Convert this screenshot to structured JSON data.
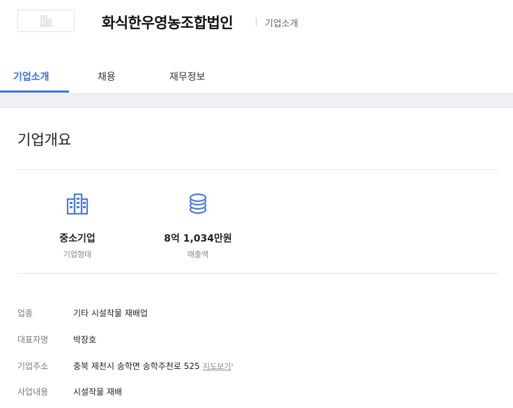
{
  "header": {
    "logo_icon": "building-icon",
    "company_name": "화식한우영농조합법인",
    "subtitle": "기업소개"
  },
  "tabs": [
    {
      "label": "기업소개",
      "active": true
    },
    {
      "label": "채용",
      "active": false
    },
    {
      "label": "재무정보",
      "active": false
    }
  ],
  "overview": {
    "title": "기업개요",
    "stats": [
      {
        "icon": "building-icon",
        "value": "중소기업",
        "label": "기업형태"
      },
      {
        "icon": "coins-icon",
        "value": "8억 1,034만원",
        "label": "매출액"
      }
    ]
  },
  "info": {
    "rows": [
      {
        "label": "업종",
        "value": "기타 시설작물 재배업"
      },
      {
        "label": "대표자명",
        "value": "박창호"
      },
      {
        "label": "기업주소",
        "value": "충북 제천시 송학면 송학주천로 525",
        "link": "지도보기",
        "link_icon": "chevron-right-icon"
      },
      {
        "label": "사업내용",
        "value": "시설작물 재배"
      }
    ]
  },
  "colors": {
    "accent": "#3b6fd6",
    "icon": "#4a7be0"
  }
}
